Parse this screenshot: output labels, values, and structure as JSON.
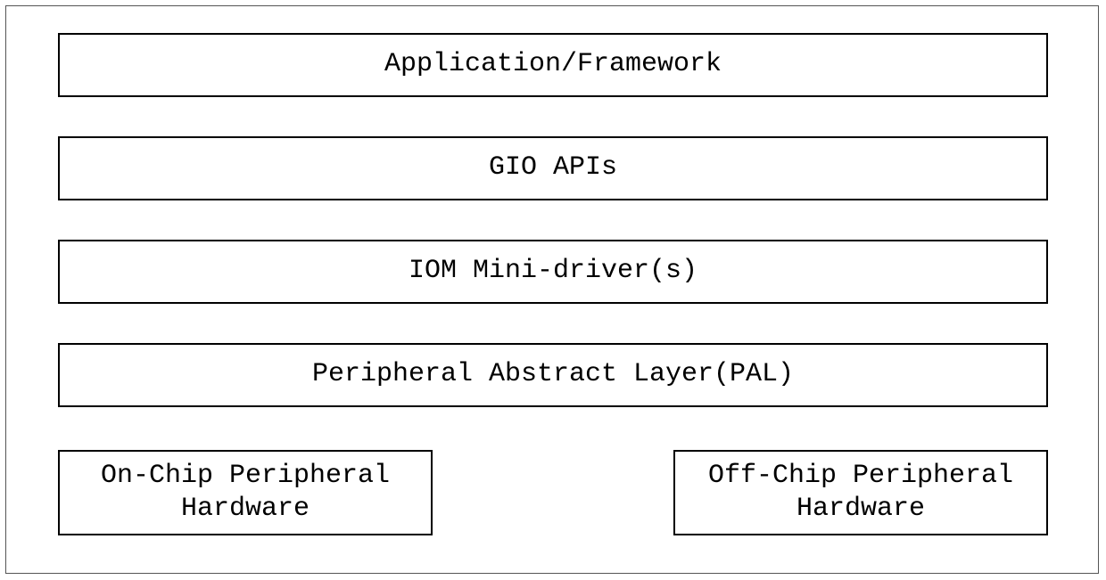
{
  "layers": {
    "l1": "Application/Framework",
    "l2": "GIO APIs",
    "l3": "IOM Mini-driver(s)",
    "l4": "Peripheral Abstract Layer(PAL)",
    "l5a": "On-Chip Peripheral Hardware",
    "l5b": "Off-Chip Peripheral Hardware"
  }
}
